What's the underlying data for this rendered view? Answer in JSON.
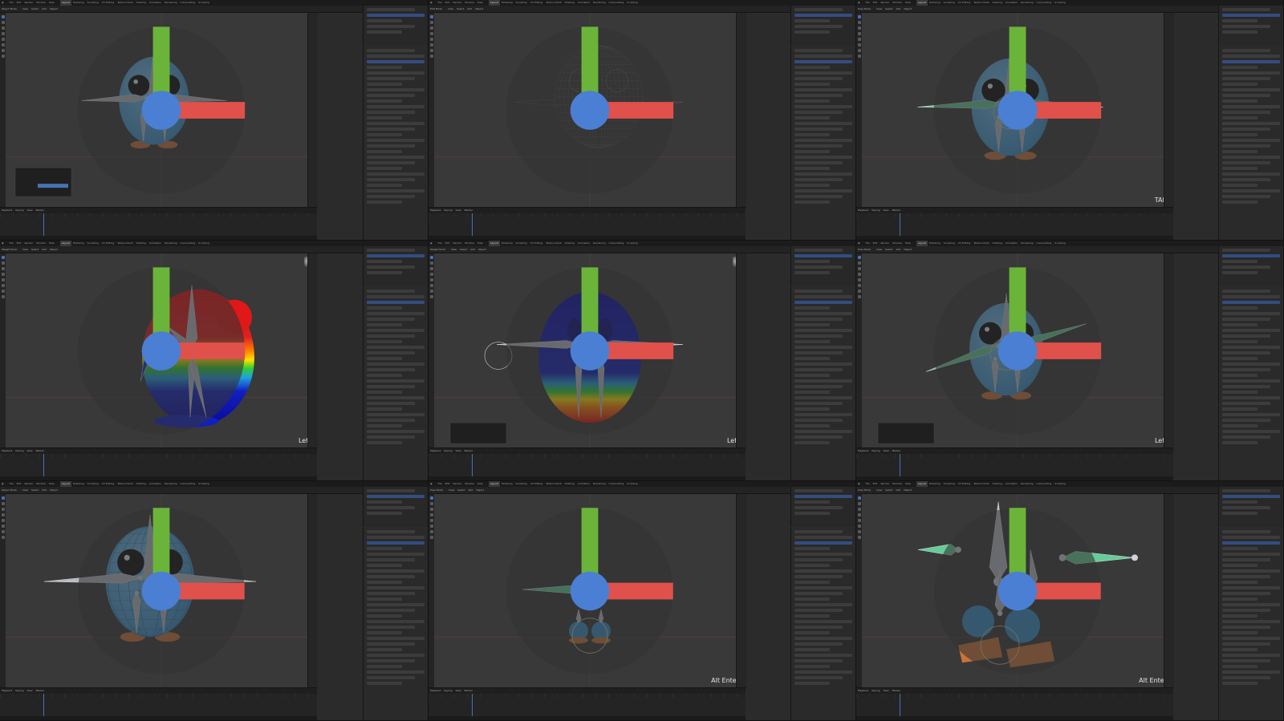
{
  "app": "Blender",
  "topmenu": [
    "File",
    "Edit",
    "Render",
    "Window",
    "Help"
  ],
  "workspaces": [
    "Layout",
    "Modeling",
    "Sculpting",
    "UV Editing",
    "Texture Paint",
    "Shading",
    "Animation",
    "Rendering",
    "Compositing",
    "Scripting"
  ],
  "header_items": [
    "Object Mode",
    "View",
    "Select",
    "Add",
    "Object"
  ],
  "timeline_items": [
    "Playback",
    "Keying",
    "View",
    "Marker"
  ],
  "colors": {
    "accent": "#4772b3",
    "bone": "#b8bcc2",
    "bone_selected": "#66cc99",
    "bird_blue": "#3a8fc9",
    "feet": "#c8743a"
  },
  "panels": [
    {
      "id": "p1",
      "scene": "blue-bird-rig-front",
      "mode": "Object Mode",
      "overlay_text": ""
    },
    {
      "id": "p2",
      "scene": "wireframe-bird",
      "mode": "Edit Mode",
      "overlay_text": ""
    },
    {
      "id": "p3",
      "scene": "blue-bird-bone-select",
      "mode": "Pose Mode",
      "overlay_text": "TAB"
    },
    {
      "id": "p4",
      "scene": "weight-paint-side",
      "mode": "Weight Paint",
      "overlay_text": "Left"
    },
    {
      "id": "p5",
      "scene": "weight-paint-front",
      "mode": "Weight Paint",
      "overlay_text": "Left"
    },
    {
      "id": "p6",
      "scene": "blue-bird-posed",
      "mode": "Pose Mode",
      "overlay_text": "Left"
    },
    {
      "id": "p7",
      "scene": "blue-bird-rig-close",
      "mode": "Object Mode",
      "overlay_text": ""
    },
    {
      "id": "p8",
      "scene": "skeleton-only",
      "mode": "Pose Mode",
      "overlay_text": "Alt Enter"
    },
    {
      "id": "p9",
      "scene": "skeleton-perspective",
      "mode": "Pose Mode",
      "overlay_text": "Alt Enter"
    }
  ]
}
